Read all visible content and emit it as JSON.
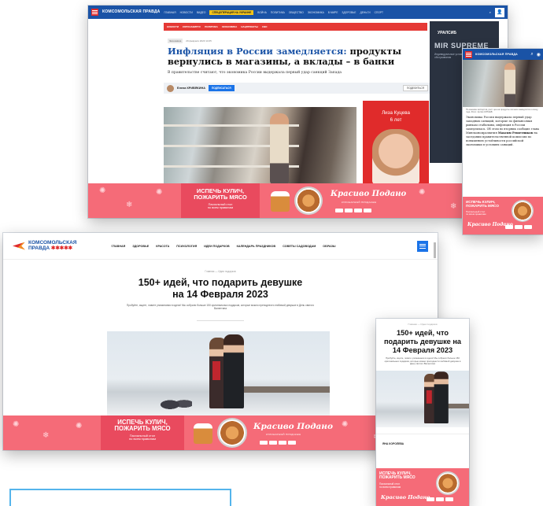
{
  "news_page": {
    "logo": "КОМСОМОЛЬСКАЯ ПРАВДА",
    "nav_highlight": "СПЕЦОПЕРАЦИЯ НА УКРАИНЕ",
    "nav_items": [
      "ГЛАВНАЯ",
      "НОВОСТИ",
      "ВИДЕО",
      "ВОЙНА",
      "ПОЛИТИКА",
      "ОБЩЕСТВО",
      "ЭКОНОМИКА",
      "В МИРЕ",
      "ЗДОРОВЬЕ",
      "ДЕНЬГИ",
      "СПОРТ"
    ],
    "subnav_items": [
      "НОВОСТИ",
      "КОРОНАВИРУС",
      "ПОЛИТИКА",
      "ЭКОНОМИКА",
      "НАЦПРОЕКТЫ",
      "СВО"
    ],
    "tag": "Экономика",
    "date": "29 февраля 2023 14:05",
    "title_blue": "Инфляция в России замедляется:",
    "title_rest": "продукты вернулись в магазины, а вклады – в банки",
    "lead": "В правительстве считают, что экономика России выдержала первый удар санкций Запада",
    "author": "Елена КРИВЯКИНА",
    "subscribe_label": "ПОДПИСАТЬСЯ",
    "share_label": "ПОДЕЛИТЬСЯ",
    "side_red_name": "Лиза Куцева",
    "side_red_age": "6 лет",
    "side_dark_brand": "УРАЛСИБ",
    "side_dark_title": "MIR SUPREME",
    "side_dark_text": "Индивидуальные условия банковского обслуживания"
  },
  "mobile_news": {
    "caption": "По мнению экспертов, рост цен на продукты питания замедлится к концу года. Фото: Артём КИТАЕВ",
    "body": "Экономика России выдержала первый удар западных санкций, которые по финансовым рынкам стабильны, инфляция в России замедлилась. Об этом во вторник сообщил глава Минэкономразвития",
    "body_bold": "Максим Решетников",
    "body_tail": "на заседании правительственной комиссии по повышению устойчивости российской экономики в условиях санкций."
  },
  "gifts_page": {
    "logo_line1": "КОМСОМОЛЬСКАЯ",
    "logo_line2": "ПРАВДА",
    "menu": [
      "ГЛАВНАЯ",
      "ЗДОРОВЬЕ",
      "КРАСОТА",
      "ПСИХОЛОГИЯ",
      "ИДЕИ ПОДАРКОВ",
      "КАЛЕНДАРЬ ПРАЗДНИКОВ",
      "СОВЕТЫ САДОВОДАМ",
      "ОБРАЗЫ"
    ],
    "crumb": "Главная — Идеи подарков",
    "title_line1": "150+ идей, что подарить девушке",
    "title_line2": "на 14 Февраля 2023",
    "lead": "Пробуйте, ищите, ловите упоминания в идеях! Мы собрали больше 150 оригинальных подарков, которые можно преподнести любимой девушке в День святого Валентина"
  },
  "mobile_gifts": {
    "crumb": "Главная — Идеи подарков",
    "title": "150+ идей, что подарить девушке на 14 Февраля 2023",
    "lead": "Пробуйте, ищите, ловите упоминания в идеях! Мы собрали больше 150 оригинальных подарков, которые можно преподнести любимой девушке в День святого Валентина",
    "author": "ЯНА КОРОЛЕВА"
  },
  "banner": {
    "headline_line1": "ИСПЕЧЬ КУЛИЧ,",
    "headline_line2": "ПОЖАРИТЬ МЯСО",
    "sub_line1": "Пасхальный стол",
    "sub_line2": "по всем правилам",
    "brand": "Красиво Подано",
    "brand_sub": "КУЛИНАРНЫЙ ПРОДАКШН",
    "close": "✕"
  },
  "colors": {
    "brand_blue": "#1a53a6",
    "accent_red": "#e02b2b",
    "banner_pink": "#f56b78",
    "highlight_yellow": "#f5c518",
    "box_outline": "#54b4ec"
  }
}
